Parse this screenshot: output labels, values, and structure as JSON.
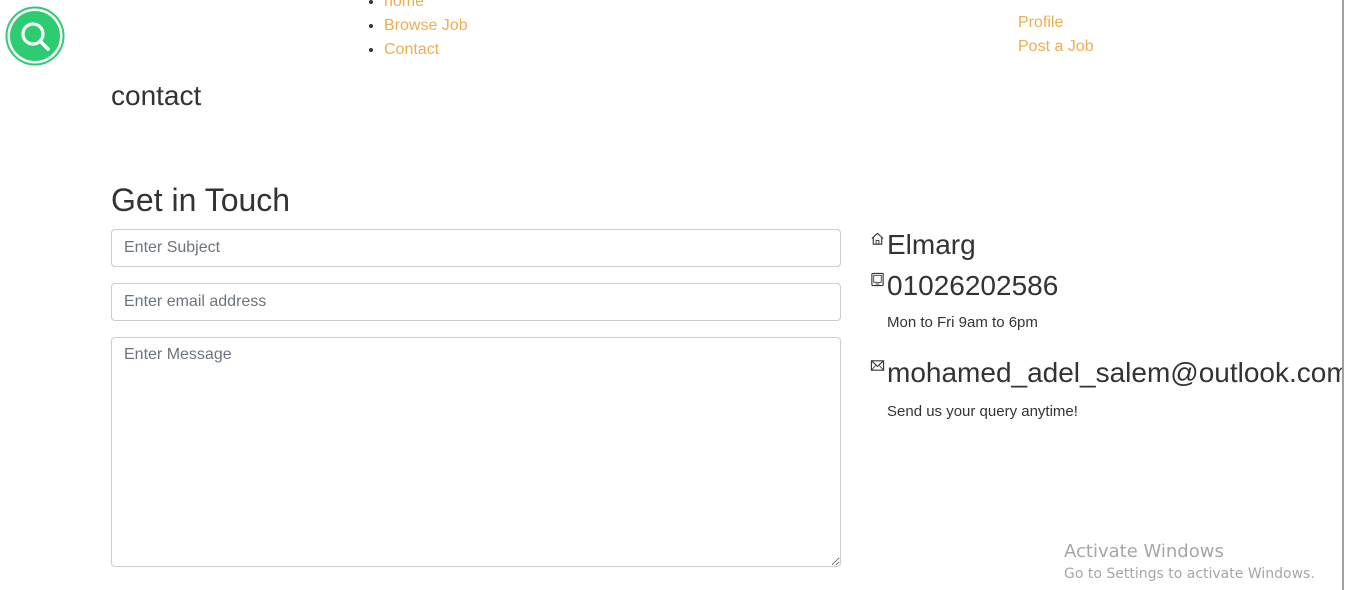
{
  "nav": {
    "items": [
      {
        "label": "home"
      },
      {
        "label": "Browse Job"
      },
      {
        "label": "Contact"
      }
    ]
  },
  "user_nav": {
    "items": [
      {
        "label": "Profile"
      },
      {
        "label": "Post a Job"
      }
    ]
  },
  "page": {
    "heading": "contact",
    "section_title": "Get in Touch"
  },
  "form": {
    "subject_placeholder": "Enter Subject",
    "email_placeholder": "Enter email address",
    "message_placeholder": "Enter Message"
  },
  "contact_info": {
    "address": "Elmarg",
    "phone": "01026202586",
    "hours": "Mon to Fri 9am to 6pm",
    "email": "mohamed_adel_salem@outlook.com",
    "email_note": "Send us your query anytime!"
  },
  "watermark": {
    "title": "Activate Windows",
    "subtitle": "Go to Settings to activate Windows."
  },
  "icons": {
    "logo": "search-logo-icon",
    "address": "home-icon",
    "phone": "tablet-icon",
    "email": "envelope-icon"
  },
  "colors": {
    "logo_green": "#2ecc71",
    "nav_link": "#f0ad4e",
    "text": "#333333"
  }
}
